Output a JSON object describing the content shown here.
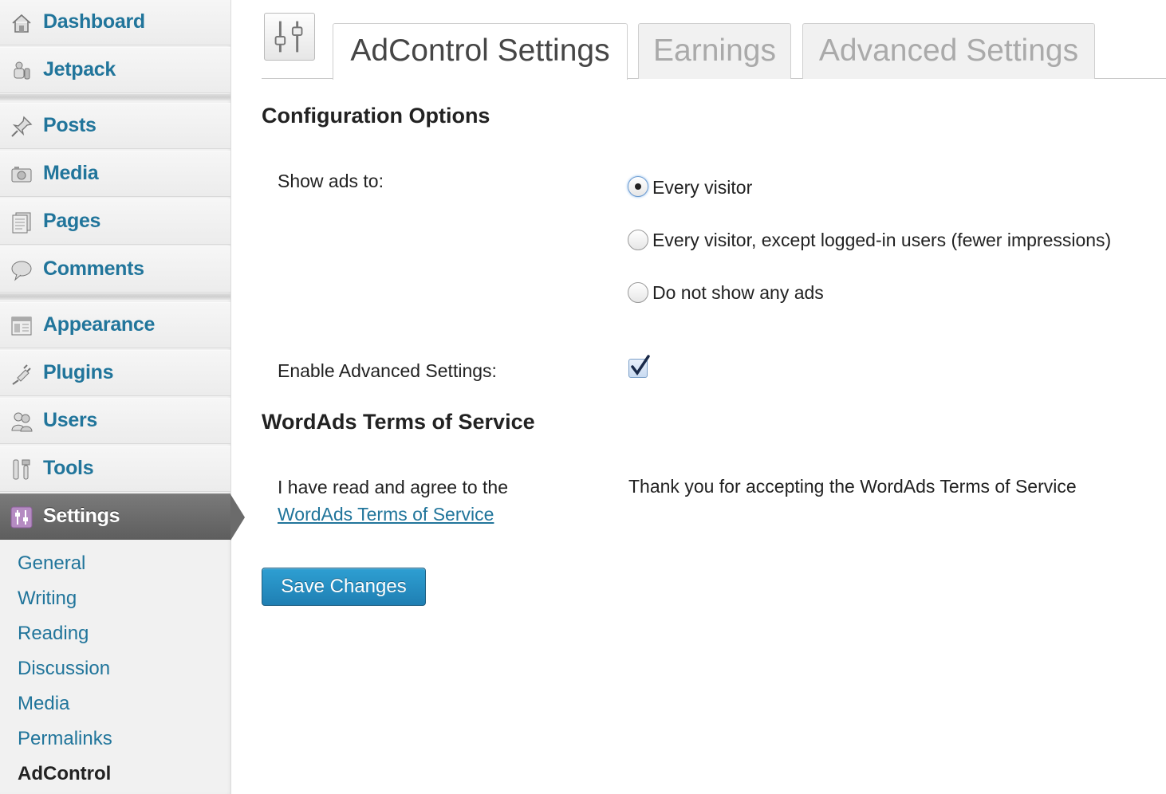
{
  "sidebar": {
    "menu": [
      {
        "label": "Dashboard",
        "icon": "dashboard-icon"
      },
      {
        "label": "Jetpack",
        "icon": "jetpack-icon"
      },
      {
        "label": "Posts",
        "icon": "pushpin-icon"
      },
      {
        "label": "Media",
        "icon": "camera-icon"
      },
      {
        "label": "Pages",
        "icon": "pages-icon"
      },
      {
        "label": "Comments",
        "icon": "speech-bubble-icon"
      },
      {
        "label": "Appearance",
        "icon": "appearance-icon"
      },
      {
        "label": "Plugins",
        "icon": "plug-icon"
      },
      {
        "label": "Users",
        "icon": "users-icon"
      },
      {
        "label": "Tools",
        "icon": "tools-icon"
      },
      {
        "label": "Settings",
        "icon": "settings-sliders-icon"
      }
    ],
    "submenu": [
      "General",
      "Writing",
      "Reading",
      "Discussion",
      "Media",
      "Permalinks",
      "AdControl"
    ],
    "current_menu": "Settings",
    "current_submenu": "AdControl"
  },
  "tabs": [
    {
      "label": "AdControl Settings",
      "active": true
    },
    {
      "label": "Earnings",
      "active": false
    },
    {
      "label": "Advanced Settings",
      "active": false
    }
  ],
  "config": {
    "heading": "Configuration Options",
    "show_ads_label": "Show ads to:",
    "options": [
      {
        "label": "Every visitor",
        "checked": true
      },
      {
        "label": "Every visitor, except logged-in users (fewer impressions)",
        "checked": false
      },
      {
        "label": "Do not show any ads",
        "checked": false
      }
    ],
    "advanced_label": "Enable Advanced Settings:",
    "advanced_checked": true
  },
  "tos": {
    "heading": "WordAds Terms of Service",
    "agree_text": "I have read and agree to the",
    "link_text": "WordAds Terms of Service",
    "message": "Thank you for accepting the WordAds Terms of Service"
  },
  "save_label": "Save Changes",
  "colors": {
    "link": "#21759b",
    "button": "#2383b8",
    "current_menu_bg": "#6b6b6b"
  }
}
